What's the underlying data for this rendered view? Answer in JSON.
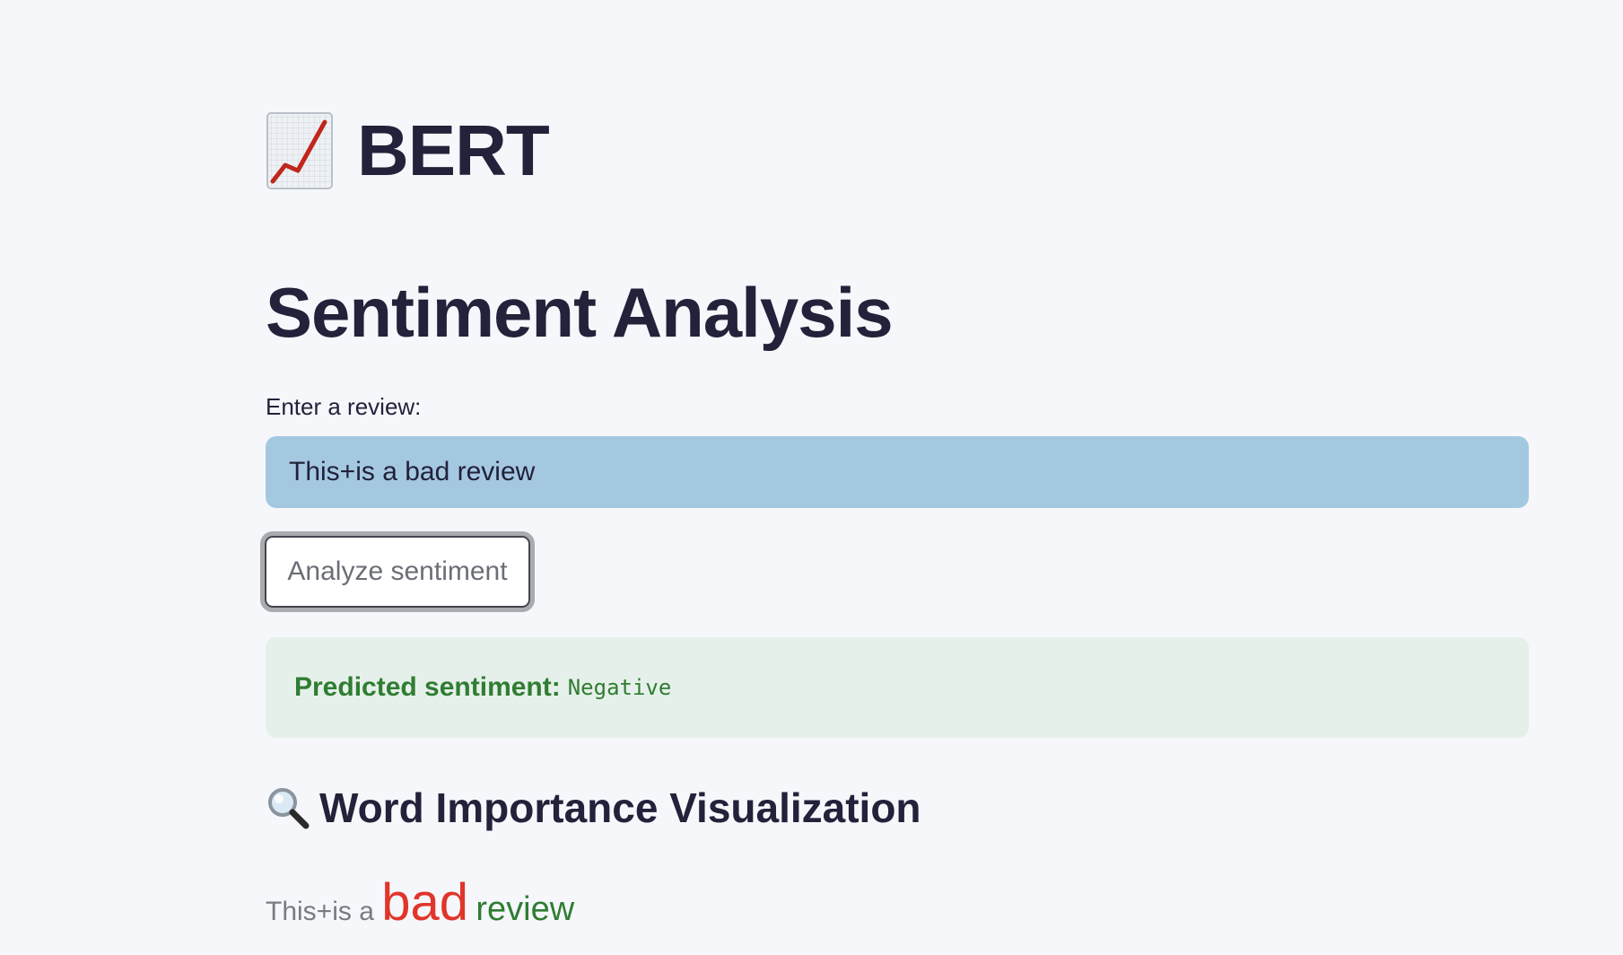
{
  "app": {
    "title": "BERT",
    "title_icon": "chart-increasing-icon"
  },
  "page": {
    "title": "Sentiment Analysis"
  },
  "review_input": {
    "label": "Enter a review:",
    "value": "This+is a bad review"
  },
  "analyze_button": {
    "label": "Analyze sentiment"
  },
  "result": {
    "label": "Predicted sentiment:",
    "value": "Negative",
    "color": "#2f7d32",
    "background": "#e6f0ea"
  },
  "word_importance": {
    "heading": "Word Importance Visualization",
    "heading_icon": "magnifying-glass-icon",
    "words": [
      {
        "text": "This+is",
        "tone": "neutral",
        "color": "#7a7a82"
      },
      {
        "text": "a",
        "tone": "neutral",
        "color": "#7a7a82"
      },
      {
        "text": "bad",
        "tone": "negative",
        "color": "#e0352b"
      },
      {
        "text": "review",
        "tone": "positive",
        "color": "#2f7d32"
      }
    ]
  }
}
